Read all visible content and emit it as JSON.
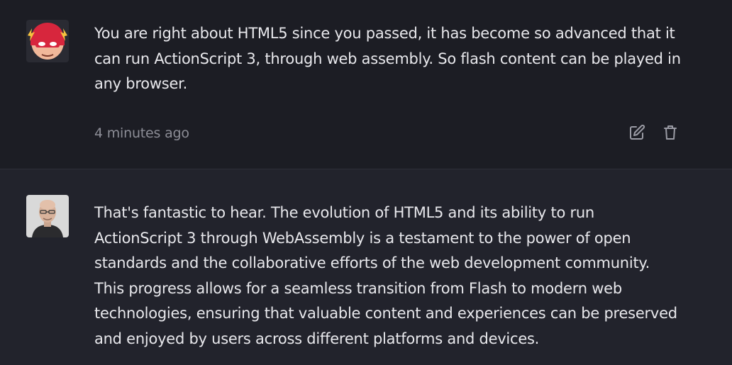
{
  "messages": [
    {
      "role": "user",
      "avatar_icon": "flash-superhero-avatar-icon",
      "text": "You are right about HTML5 since you passed, it has become so advanced that it can run ActionScript 3, through web assembly. So flash content can be played in any browser.",
      "timestamp": "4 minutes ago",
      "actions": [
        {
          "icon": "edit-icon"
        },
        {
          "icon": "trash-icon"
        }
      ]
    },
    {
      "role": "assistant",
      "avatar_icon": "bald-man-portrait-avatar",
      "text": "That's fantastic to hear. The evolution of HTML5 and its ability to run ActionScript 3 through WebAssembly is a testament to the power of open standards and the collaborative efforts of the web development community. This progress allows for a seamless transition from Flash to modern web technologies, ensuring that valuable content and experiences can be preserved and enjoyed by users across different platforms and devices."
    }
  ],
  "colors": {
    "background": "#1c1d24",
    "assistant_background": "#22232c",
    "text": "#e8e8ec",
    "muted_text": "#8c8d96",
    "icon": "#9a9ba4"
  }
}
